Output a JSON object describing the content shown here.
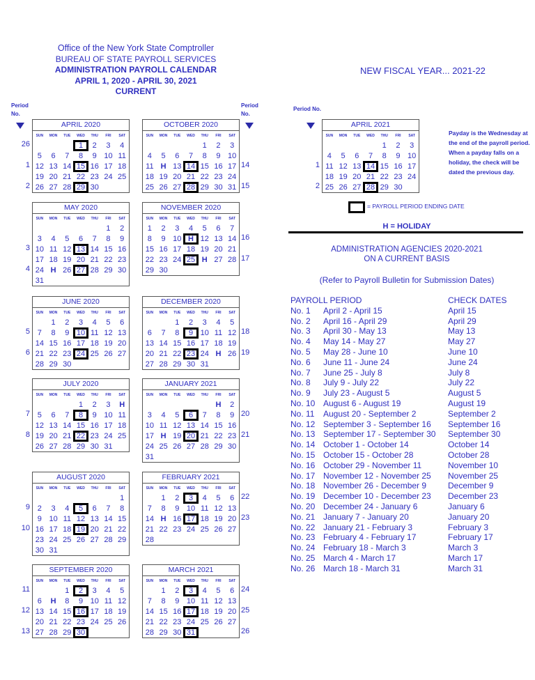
{
  "header": {
    "line1": "Office of the New York State Comptroller",
    "line2": "BUREAU OF STATE PAYROLL SERVICES",
    "line3": "ADMINISTRATION PAYROLL CALENDAR",
    "line4": "APRIL 1, 2020 - APRIL 30, 2021",
    "line5": "CURRENT"
  },
  "fiscal_year": "NEW FISCAL YEAR... 2021-22",
  "period_label": {
    "line1": "Period",
    "line2": "No.",
    "inline": "Period No."
  },
  "day_names": [
    "SUN",
    "MON",
    "TUE",
    "WED",
    "THU",
    "FRI",
    "SAT"
  ],
  "months": [
    {
      "title": "APRIL 2020",
      "start": 3,
      "days": 30,
      "hol": [],
      "end": [
        1,
        15,
        29
      ],
      "pn": [
        "26",
        "",
        "1",
        "",
        "2"
      ]
    },
    {
      "title": "MAY 2020",
      "start": 5,
      "days": 31,
      "hol": [
        25
      ],
      "end": [
        13,
        27
      ],
      "pn": [
        "",
        "",
        "3",
        "",
        "4",
        ""
      ]
    },
    {
      "title": "JUNE 2020",
      "start": 1,
      "days": 30,
      "hol": [],
      "end": [
        10,
        24
      ],
      "pn": [
        "",
        "5",
        "",
        "6",
        ""
      ]
    },
    {
      "title": "JULY 2020",
      "start": 3,
      "days": 31,
      "hol": [
        4
      ],
      "end": [
        8,
        22
      ],
      "pn": [
        "",
        "7",
        "",
        "8",
        ""
      ]
    },
    {
      "title": "AUGUST 2020",
      "start": 6,
      "days": 31,
      "hol": [],
      "end": [
        5,
        19
      ],
      "pn": [
        "",
        "9",
        "",
        "10",
        "",
        ""
      ]
    },
    {
      "title": "SEPTEMBER 2020",
      "start": 2,
      "days": 30,
      "hol": [
        7
      ],
      "end": [
        2,
        16,
        30
      ],
      "pn": [
        "11",
        "",
        "12",
        "",
        "13"
      ]
    },
    {
      "title": "OCTOBER 2020",
      "start": 4,
      "days": 31,
      "hol": [
        12
      ],
      "end": [
        14,
        28
      ],
      "pn": [
        "",
        "",
        "14",
        "",
        "15"
      ]
    },
    {
      "title": "NOVEMBER 2020",
      "start": 0,
      "days": 30,
      "hol": [
        11,
        26
      ],
      "end": [
        11,
        25
      ],
      "pn": [
        "",
        "16",
        "",
        "17",
        ""
      ]
    },
    {
      "title": "DECEMBER 2020",
      "start": 2,
      "days": 31,
      "hol": [
        25
      ],
      "end": [
        9,
        23
      ],
      "pn": [
        "",
        "18",
        "",
        "19",
        ""
      ]
    },
    {
      "title": "JANUARY 2021",
      "start": 5,
      "days": 31,
      "hol": [
        1,
        18
      ],
      "end": [
        6,
        20
      ],
      "pn": [
        "",
        "20",
        "",
        "21",
        "",
        ""
      ]
    },
    {
      "title": "FEBRUARY 2021",
      "start": 1,
      "days": 28,
      "hol": [
        15
      ],
      "end": [
        3,
        17
      ],
      "pn": [
        "22",
        "",
        "23",
        "",
        ""
      ]
    },
    {
      "title": "MARCH 2021",
      "start": 1,
      "days": 31,
      "hol": [],
      "end": [
        3,
        17,
        31
      ],
      "pn": [
        "24",
        "",
        "25",
        "",
        "26"
      ]
    },
    {
      "title": "APRIL 2021",
      "start": 4,
      "days": 30,
      "hol": [],
      "end": [
        14,
        28
      ],
      "pn": [
        "",
        "",
        "1",
        "",
        "2"
      ]
    }
  ],
  "note": "Payday is the Wednesday at the end of the payroll period. When a payday falls on a holiday, the check will be dated the previous day.",
  "legend": {
    "ending_date": "= PAYROLL PERIOD ENDING DATE",
    "holiday": "H = HOLIDAY"
  },
  "agencies": {
    "line1": "ADMINISTRATION AGENCIES 2020-2021",
    "line2": "ON A CURRENT BASIS"
  },
  "refer": "(Refer to Payroll Bulletin for Submission Dates)",
  "periods_table": {
    "header_period": "PAYROLL PERIOD",
    "header_check": "CHECK DATES",
    "rows": [
      [
        "No. 1",
        "April 2 - April 15",
        "April 15"
      ],
      [
        "No. 2",
        "April 16 - April 29",
        "April 29"
      ],
      [
        "No. 3",
        "April 30 - May 13",
        "May 13"
      ],
      [
        "No. 4",
        "May 14 - May 27",
        "May 27"
      ],
      [
        "No. 5",
        "May 28 - June 10",
        "June 10"
      ],
      [
        "No. 6",
        "June 11 - June 24",
        "June 24"
      ],
      [
        "No. 7",
        "June 25 - July 8",
        "July 8"
      ],
      [
        "No. 8",
        "July 9 - July 22",
        "July 22"
      ],
      [
        "No. 9",
        "July 23 - August 5",
        "August 5"
      ],
      [
        "No. 10",
        "August 6 - August 19",
        "August 19"
      ],
      [
        "No. 11",
        "August 20 - September 2",
        "September 2"
      ],
      [
        "No. 12",
        "September 3 - September 16",
        "September 16"
      ],
      [
        "No. 13",
        "September 17 - September 30",
        "September 30"
      ],
      [
        "No. 14",
        "October 1 - October 14",
        "October 14"
      ],
      [
        "No. 15",
        "October 15 - October 28",
        "October 28"
      ],
      [
        "No. 16",
        "October 29 - November 11",
        "November 10"
      ],
      [
        "No. 17",
        "November 12 - November 25",
        "November 25"
      ],
      [
        "No. 18",
        "November 26 - December 9",
        "December 9"
      ],
      [
        "No. 19",
        "December 10 - December 23",
        "December 23"
      ],
      [
        "No. 20",
        "December 24 - January 6",
        "January 6"
      ],
      [
        "No. 21",
        "January 7 - January 20",
        "January 20"
      ],
      [
        "No. 22",
        "January 21 - February 3",
        "February 3"
      ],
      [
        "No. 23",
        "February 4 - February 17",
        "February 17"
      ],
      [
        "No. 24",
        "February 18 - March 3",
        "March 3"
      ],
      [
        "No. 25",
        "March 4 - March 17",
        "March 17"
      ],
      [
        "No. 26",
        "March 18 - March 31",
        "March 31"
      ]
    ]
  },
  "colors": {
    "text": "#3030c0",
    "box": "#000000"
  }
}
